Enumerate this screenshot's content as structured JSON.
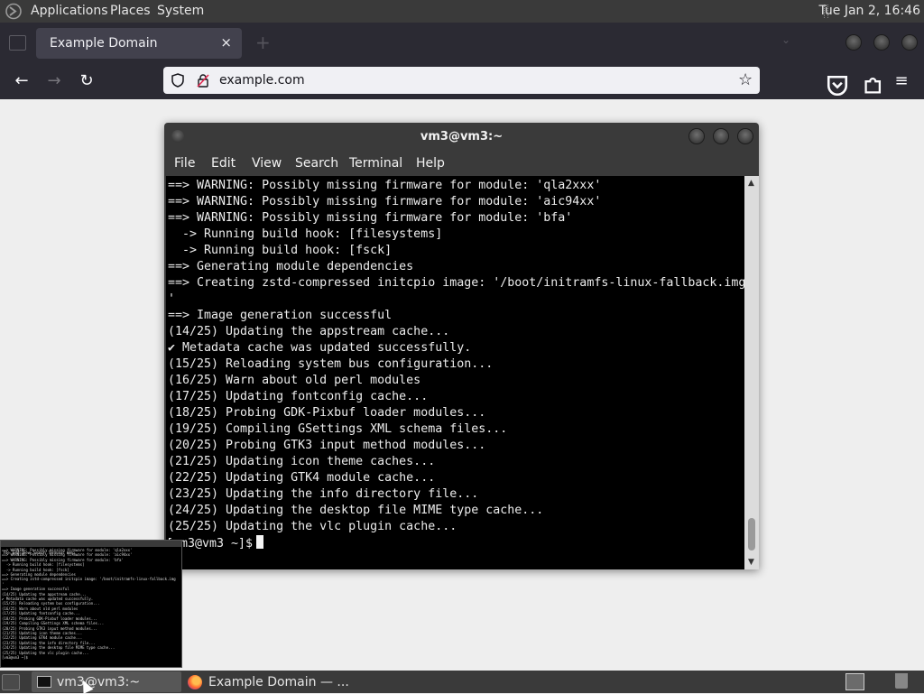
{
  "top_panel": {
    "menus": [
      "Applications",
      "Places",
      "System"
    ],
    "clock": "Tue Jan  2, 16:46"
  },
  "browser": {
    "tab_title": "Example Domain",
    "tab_close": "×",
    "url": "example.com"
  },
  "terminal": {
    "title": "vm3@vm3:~",
    "menus": [
      "File",
      "Edit",
      "View",
      "Search",
      "Terminal",
      "Help"
    ],
    "lines": [
      "==> WARNING: Possibly missing firmware for module: 'qla2xxx'",
      "==> WARNING: Possibly missing firmware for module: 'aic94xx'",
      "==> WARNING: Possibly missing firmware for module: 'bfa'",
      "  -> Running build hook: [filesystems]",
      "  -> Running build hook: [fsck]",
      "==> Generating module dependencies",
      "==> Creating zstd-compressed initcpio image: '/boot/initramfs-linux-fallback.img",
      "'",
      "==> Image generation successful",
      "(14/25) Updating the appstream cache...",
      "✔ Metadata cache was updated successfully.",
      "(15/25) Reloading system bus configuration...",
      "(16/25) Warn about old perl modules",
      "(17/25) Updating fontconfig cache...",
      "(18/25) Probing GDK-Pixbuf loader modules...",
      "(19/25) Compiling GSettings XML schema files...",
      "(20/25) Probing GTK3 input method modules...",
      "(21/25) Updating icon theme caches...",
      "(22/25) Updating GTK4 module cache...",
      "(23/25) Updating the info directory file...",
      "(24/25) Updating the desktop file MIME type cache...",
      "(25/25) Updating the vlc plugin cache..."
    ],
    "prompt": "[vm3@vm3 ~]$"
  },
  "thumbnail": {
    "menus": [
      "File",
      "Edit",
      "View",
      "Search",
      "Terminal",
      "Help"
    ]
  },
  "taskbar": {
    "items": [
      {
        "label": "vm3@vm3:~"
      },
      {
        "label": "Example Domain — ..."
      }
    ]
  }
}
